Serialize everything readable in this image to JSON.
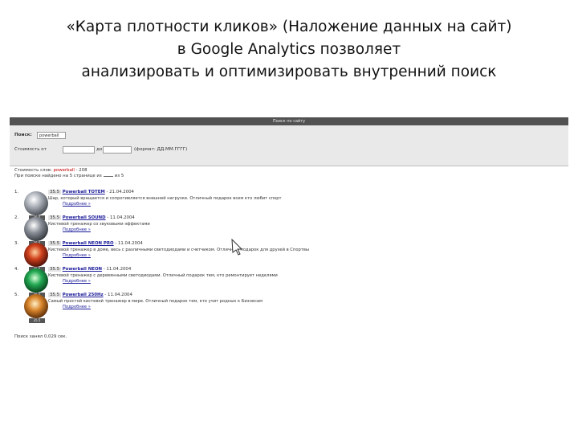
{
  "slide": {
    "title_lines": [
      "«Карта плотности кликов» (Наложение данных на сайт)",
      "в Google Analytics позволяет",
      "анализировать и оптимизировать внутренний поиск"
    ]
  },
  "site": {
    "bar_title": "Поиск по сайту",
    "search_label": "Поиск:",
    "search_value": "powerball",
    "cost_label": "Стоимость от",
    "cost_from_placeholder": "до",
    "cost_to_label": "до",
    "cost_format": "(формат: ДД.ММ.ГГГГ)",
    "meta_line1_prefix": "Стоимость слов:",
    "meta_line1_keyword": "powerball",
    "meta_line1_suffix": "- 208",
    "meta_line2": "При поиске найдено на 5 странице из",
    "meta_line2_end": "из 5",
    "results": [
      {
        "num": "1.",
        "price": "35.5",
        "name": "Powerball ТОТЕМ",
        "date": "- 21.04.2004",
        "desc": "Шар, который вращается и сопротивляется внешней нагрузке. Отличный подарок всем кто любит спорт",
        "more": "Подробнее »",
        "cap": "35.5",
        "color": "#8a8f96"
      },
      {
        "num": "2.",
        "price": "35.5",
        "name": "Powerball SOUND",
        "date": "- 11.04.2004",
        "desc": "Кистевой тренажер со звуковыми эффектами",
        "more": "Подробнее »",
        "cap": "35.5",
        "color": "#6a6f78"
      },
      {
        "num": "3.",
        "price": "35.5",
        "name": "Powerball NEON PRO",
        "date": "- 11.04.2004",
        "desc": "Кистевой тренажер в доме, весь с различными светодиодами и счетчиком. Отличный подарок для друзей в Спортвы",
        "more": "Подробнее »",
        "cap": "35.5",
        "color": "#c83218"
      },
      {
        "num": "4.",
        "price": "35.5",
        "name": "Powerball NEON",
        "date": "- 11.04.2004",
        "desc": "Кистевой тренажер с деревянными светодиодами. Отличный подарок тем, кто ремонтирует неделями",
        "more": "Подробнее »",
        "cap": "35.5",
        "color": "#1c9a4a"
      },
      {
        "num": "5.",
        "price": "35.5",
        "name": "Powerball 250Hz",
        "date": "- 11.04.2004",
        "desc": "Самый простой кистевой тренажер в мире. Отличный подарок тем, кто учит родных к Бизнесам",
        "more": "Подробнее »",
        "cap": "35.5",
        "color": "#d0802a"
      }
    ],
    "footer": "Поиск занял 0,029 сек."
  }
}
